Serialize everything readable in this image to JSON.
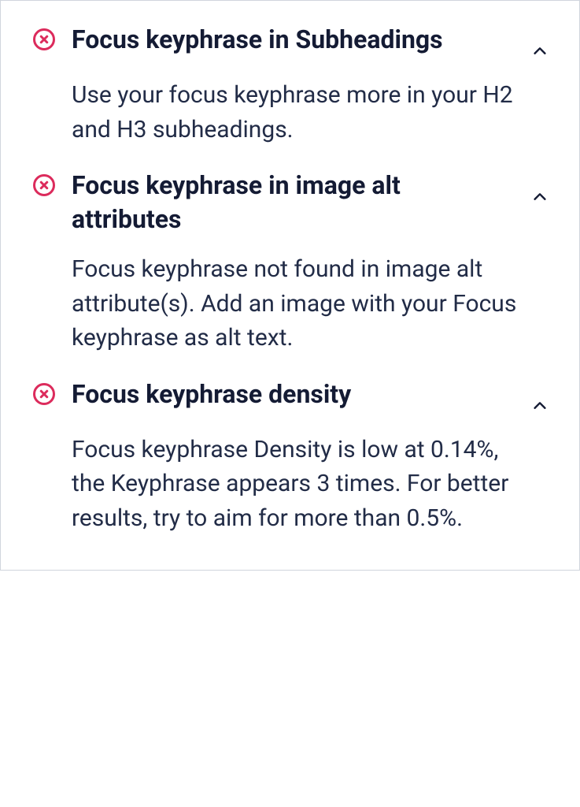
{
  "items": [
    {
      "title": "Focus keyphrase in Subheadings",
      "description": "Use your focus keyphrase more in your H2 and H3 subheadings."
    },
    {
      "title": "Focus keyphrase in image alt attributes",
      "description": "Focus keyphrase not found in image alt attribute(s). Add an image with your Focus keyphrase as alt text."
    },
    {
      "title": "Focus keyphrase density",
      "description": "Focus keyphrase Density is low at 0.14%, the Keyphrase appears 3 times. For better results, try to aim for more than 0.5%."
    }
  ]
}
